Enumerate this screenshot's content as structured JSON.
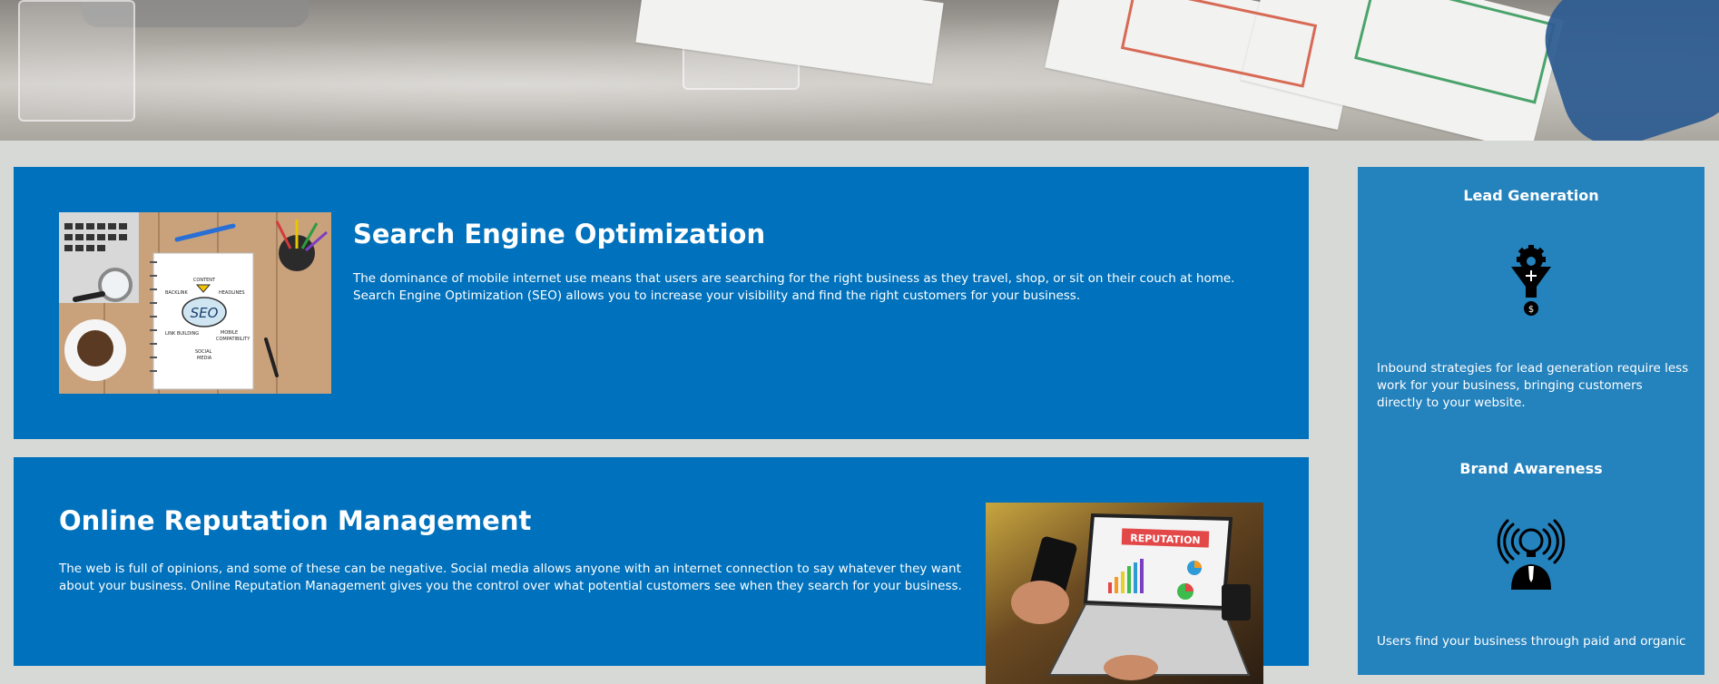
{
  "seo": {
    "title": "Search Engine Optimization",
    "body": "The dominance of mobile internet use means that users are searching for the right business as they travel, shop, or sit on their couch at home. Search Engine Optimization (SEO) allows you to increase your visibility and find the right customers for your business.",
    "image_words": [
      "CONTENT",
      "BACKLINK",
      "HEADLINES",
      "SEO",
      "LINK BUILDING",
      "MOBILE",
      "COMPATIBILITY",
      "SOCIAL",
      "MEDIA"
    ]
  },
  "orm": {
    "title": "Online Reputation Management",
    "body": "The web is full of opinions, and some of these can be negative. Social media allows anyone with an internet connection to say whatever they want about your business. Online Reputation Management gives you the control over what potential customers see when they search for your business.",
    "image_word": "REPUTATION"
  },
  "sidebar": {
    "lead": {
      "title": "Lead Generation",
      "icon": "funnel-gear-dollar-icon",
      "body": "Inbound strategies for lead generation require less work for your business, bringing customers directly to your website."
    },
    "brand": {
      "title": "Brand Awareness",
      "icon": "person-lightbulb-broadcast-icon",
      "body": "Users find your business through paid and organic"
    }
  },
  "colors": {
    "card_blue": "#0071bc",
    "sidebar_blue": "#2482bd",
    "page_bg": "#d6d9d6"
  }
}
